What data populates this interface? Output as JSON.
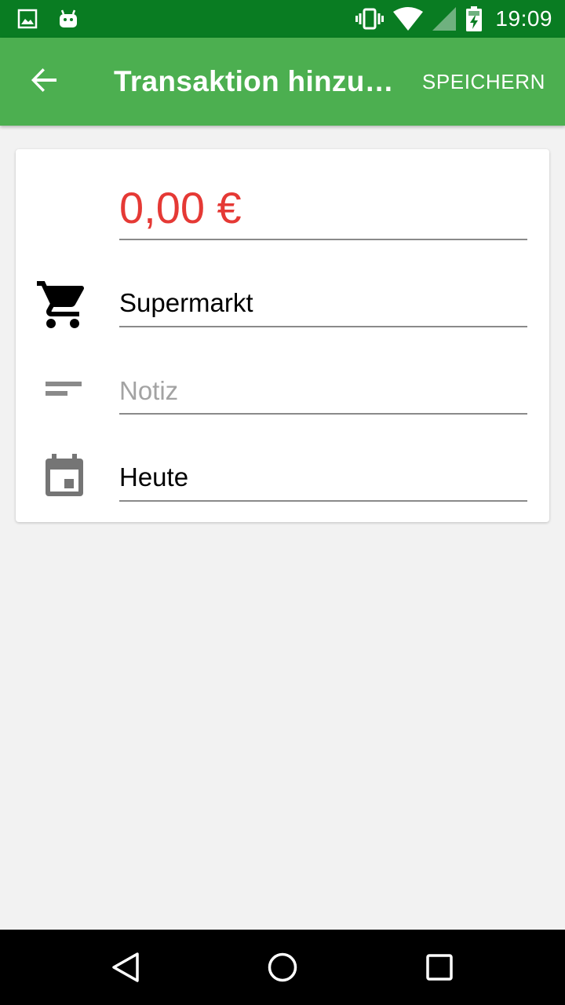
{
  "status_bar": {
    "time": "19:09",
    "icons": [
      "image-icon",
      "android-icon",
      "vibrate-icon",
      "wifi-icon",
      "signal-icon",
      "battery-charging-icon"
    ]
  },
  "app_bar": {
    "title": "Transaktion hinzufügen",
    "save_label": "SPEICHERN",
    "back_icon": "arrow-back-icon"
  },
  "form": {
    "amount": "0,00 €",
    "category": "Supermarkt",
    "category_icon": "shopping-cart-icon",
    "note_value": "",
    "note_placeholder": "Notiz",
    "note_icon": "short-text-icon",
    "date": "Heute",
    "date_icon": "calendar-icon"
  },
  "nav_bar": {
    "icons": [
      "back-triangle-icon",
      "home-circle-icon",
      "recents-square-icon"
    ]
  },
  "colors": {
    "status_bar": "#097c22",
    "app_bar": "#4caf50",
    "amount_negative": "#e53935",
    "background": "#f2f2f2"
  }
}
